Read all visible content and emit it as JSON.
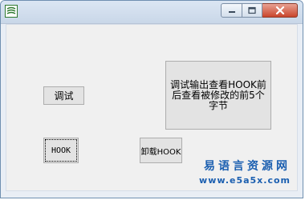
{
  "window": {
    "icon": "app-logo-icon",
    "controls": {
      "minimize_icon": "minimize-icon",
      "maximize_icon": "maximize-icon",
      "close_icon": "close-icon"
    }
  },
  "buttons": {
    "debug": "调试",
    "hook": "HOOK",
    "unload_hook": "卸载HOOK",
    "debug_output": "调试输出查看HOOK前后查看被修改的前5个字节"
  },
  "watermark": {
    "line1": "易语言资源网",
    "line2": "www.e5a5x.com"
  },
  "colors": {
    "close_button": "#c9462c",
    "watermark": "#1b5fb0"
  }
}
